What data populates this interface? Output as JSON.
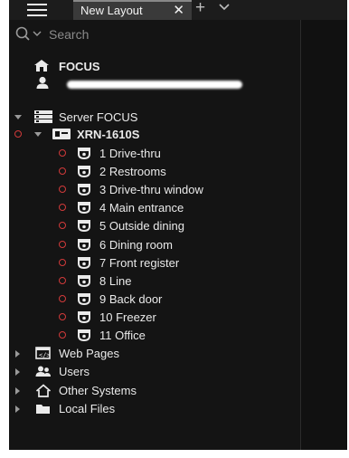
{
  "window": {
    "tab_title": "New Layout",
    "tab_close_glyph": "✕",
    "add_tab_glyph": "+",
    "menu_icon": "hamburger-menu-icon"
  },
  "search": {
    "placeholder": "Search",
    "icon": "search-icon"
  },
  "tree": {
    "root": {
      "label": "FOCUS",
      "icon": "home-icon"
    },
    "user": {
      "label": "",
      "icon": "user-icon",
      "redacted": true
    },
    "server": {
      "label": "Server FOCUS",
      "icon": "server-icon",
      "expanded": true
    },
    "recorder": {
      "label": "XRN-1610S",
      "icon": "recorder-icon",
      "expanded": true
    },
    "cameras": [
      {
        "label": "1 Drive-thru"
      },
      {
        "label": "2 Restrooms"
      },
      {
        "label": "3 Drive-thru window"
      },
      {
        "label": "4 Main entrance"
      },
      {
        "label": "5 Outside dining"
      },
      {
        "label": "6 Dining room"
      },
      {
        "label": "7 Front register"
      },
      {
        "label": "8 Line"
      },
      {
        "label": "9 Back door"
      },
      {
        "label": "10 Freezer"
      },
      {
        "label": "11 Office"
      }
    ],
    "groups": [
      {
        "label": "Web Pages",
        "icon": "web-page-icon"
      },
      {
        "label": "Users",
        "icon": "users-icon"
      },
      {
        "label": "Other Systems",
        "icon": "house-outline-icon"
      },
      {
        "label": "Local Files",
        "icon": "folder-icon"
      }
    ]
  },
  "colors": {
    "background": "#141414",
    "status_offline": "#d23a3a",
    "text": "#eaeaea"
  }
}
